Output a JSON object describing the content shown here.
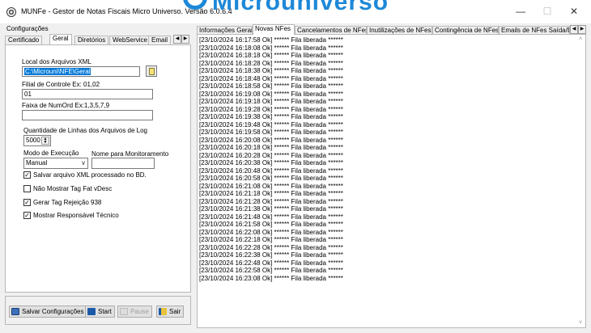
{
  "window": {
    "title": "MUNFe - Gestor de Notas Fiscais Micro Universo. Versão 6.0.6.4",
    "brand": "Microuniverso",
    "minimize": "—",
    "maximize": "☐",
    "close": "✕"
  },
  "config": {
    "caption": "Configurações",
    "tabs": [
      "Certificado",
      "Geral",
      "Diretórios",
      "WebService",
      "Email"
    ],
    "active_tab": "Geral",
    "xml_dir_label": "Local dos Arquivos XML",
    "xml_dir_value": "C:\\Microuni\\NFE\\Geral",
    "filial_label": "Filial de Controle Ex: 01,02",
    "filial_value": "01",
    "faixa_label": "Faixa de NumOrd Ex:1,3,5,7,9",
    "faixa_value": "",
    "log_lines_label": "Quantidade de Linhas dos Arquivos de Log",
    "log_lines_value": "5000",
    "exec_mode_label": "Modo de Execução",
    "exec_mode_value": "Manual",
    "monitor_name_label": "Nome para Monitoramento",
    "monitor_name_value": "",
    "checkboxes": [
      {
        "label": "Salvar arquivo XML processado no BD.",
        "checked": true
      },
      {
        "label": "Não Mostrar Tag Fat vDesc",
        "checked": false
      },
      {
        "label": "Gerar Tag Rejeição 938",
        "checked": true
      },
      {
        "label": "Mostrar Responsável Técnico",
        "checked": true
      }
    ]
  },
  "buttons": {
    "save": "Salvar Configurações",
    "start": "Start",
    "pause": "Pause",
    "exit": "Sair"
  },
  "log_tabs": [
    "Informações Gerais",
    "Novas NFes",
    "Cancelamentos de NFes",
    "Inutilizações de NFes",
    "Contingência de NFes",
    "Emails de NFes Saída/E"
  ],
  "active_log_tab": "Novas NFes",
  "log_lines": [
    "[23/10/2024 16:17:58 Ok] ****** Fila liberada ******",
    "[23/10/2024 16:18:08 Ok] ****** Fila liberada ******",
    "[23/10/2024 16:18:18 Ok] ****** Fila liberada ******",
    "[23/10/2024 16:18:28 Ok] ****** Fila liberada ******",
    "[23/10/2024 16:18:38 Ok] ****** Fila liberada ******",
    "[23/10/2024 16:18:48 Ok] ****** Fila liberada ******",
    "[23/10/2024 16:18:58 Ok] ****** Fila liberada ******",
    "[23/10/2024 16:19:08 Ok] ****** Fila liberada ******",
    "[23/10/2024 16:19:18 Ok] ****** Fila liberada ******",
    "[23/10/2024 16:19:28 Ok] ****** Fila liberada ******",
    "[23/10/2024 16:19:38 Ok] ****** Fila liberada ******",
    "[23/10/2024 16:19:48 Ok] ****** Fila liberada ******",
    "[23/10/2024 16:19:58 Ok] ****** Fila liberada ******",
    "[23/10/2024 16:20:08 Ok] ****** Fila liberada ******",
    "[23/10/2024 16:20:18 Ok] ****** Fila liberada ******",
    "[23/10/2024 16:20:28 Ok] ****** Fila liberada ******",
    "[23/10/2024 16:20:38 Ok] ****** Fila liberada ******",
    "[23/10/2024 16:20:48 Ok] ****** Fila liberada ******",
    "[23/10/2024 16:20:58 Ok] ****** Fila liberada ******",
    "[23/10/2024 16:21:08 Ok] ****** Fila liberada ******",
    "[23/10/2024 16:21:18 Ok] ****** Fila liberada ******",
    "[23/10/2024 16:21:28 Ok] ****** Fila liberada ******",
    "[23/10/2024 16:21:38 Ok] ****** Fila liberada ******",
    "[23/10/2024 16:21:48 Ok] ****** Fila liberada ******",
    "[23/10/2024 16:21:58 Ok] ****** Fila liberada ******",
    "[23/10/2024 16:22:08 Ok] ****** Fila liberada ******",
    "[23/10/2024 16:22:18 Ok] ****** Fila liberada ******",
    "[23/10/2024 16:22:28 Ok] ****** Fila liberada ******",
    "[23/10/2024 16:22:38 Ok] ****** Fila liberada ******",
    "[23/10/2024 16:22:48 Ok] ****** Fila liberada ******",
    "[23/10/2024 16:22:58 Ok] ****** Fila liberada ******",
    "[23/10/2024 16:23:08 Ok] ****** Fila liberada ******"
  ],
  "colors": {
    "selection": "#0078d7",
    "brand": "#1e88d8"
  }
}
